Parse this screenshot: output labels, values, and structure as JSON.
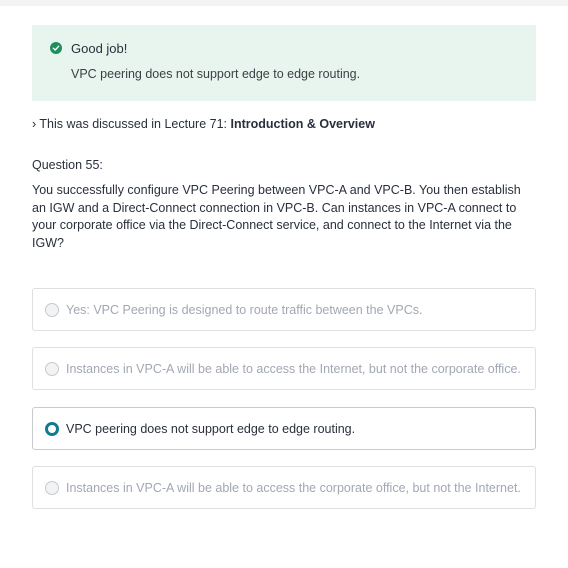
{
  "feedback": {
    "icon": "check-circle-icon",
    "title": "Good job!",
    "message": "VPC peering does not support edge to edge routing."
  },
  "lecture_ref": {
    "prefix": "› This was discussed in Lecture 71: ",
    "title": "Introduction & Overview"
  },
  "question": {
    "number": "Question 55:",
    "text": "You successfully configure VPC Peering between VPC-A  and VPC-B. You then establish an IGW and a Direct-Connect connection in VPC-B. Can instances in VPC-A connect to your corporate office via the Direct-Connect service, and connect to the Internet via the IGW?"
  },
  "options": [
    {
      "label": "Yes: VPC Peering is designed to route traffic between the VPCs.",
      "selected": false
    },
    {
      "label": "Instances in VPC-A will be able to access the Internet, but not the corporate office.",
      "selected": false
    },
    {
      "label": "VPC peering does not support edge to edge routing.",
      "selected": true
    },
    {
      "label": "Instances in VPC-A will be able to access the corporate office, but not the Internet.",
      "selected": false
    }
  ],
  "colors": {
    "success": "#1e8f5a",
    "feedback_bg": "#e8f5ee",
    "accent": "#0f7c90"
  }
}
